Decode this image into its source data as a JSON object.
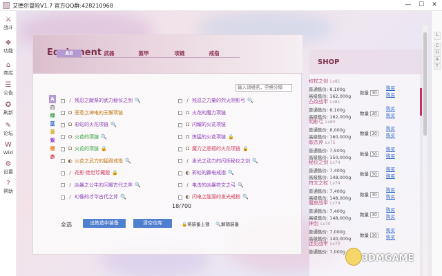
{
  "window": {
    "title": "艾德尔冒险V1.7 官方QQ群:428210968",
    "min": "—",
    "max": "☐",
    "close": "✕"
  },
  "sidebar": [
    {
      "icon": "⚔",
      "label": "战斗"
    },
    {
      "icon": "❖",
      "label": "功能"
    },
    {
      "icon": "⌂",
      "label": "商店"
    },
    {
      "icon": "☰",
      "label": "公告"
    },
    {
      "icon": "✪",
      "label": "刷新"
    },
    {
      "icon": "✎",
      "label": "论坛"
    },
    {
      "icon": "W",
      "label": "Wiki"
    },
    {
      "icon": "⚙",
      "label": "设置"
    },
    {
      "icon": "?",
      "label": "帮助"
    }
  ],
  "equipment": {
    "title": "Equipment",
    "tabs": [
      "All",
      "武器",
      "盔甲",
      "项链",
      "戒指"
    ],
    "search_placeholder": "输入词组名，空格分隔",
    "rarity": [
      "A",
      "白",
      "绿",
      "蓝",
      "黄",
      "紫",
      "橙",
      "赤"
    ],
    "left_items": [
      {
        "name": "残忍之献祭的武力秘仪之剑",
        "color": "#8a3db5",
        "wpn": "/",
        "tail": "🔍"
      },
      {
        "name": "恶意之神电的无懈项链",
        "color": "#c07a1a",
        "wpn": "Ω",
        "tail": ""
      },
      {
        "name": "彩虹的火花项链",
        "color": "#8a3db5",
        "wpn": "Ω",
        "tail": "🔍"
      },
      {
        "name": "火花的项链",
        "color": "#2f9b3b",
        "wpn": "Ω",
        "tail": "🔍"
      },
      {
        "name": "火花的项链",
        "color": "#2f9b3b",
        "wpn": "Ω",
        "tail": "🔒"
      },
      {
        "name": "火花之武力的猛踢戒指",
        "color": "#c07a1a",
        "wpn": "◐",
        "tail": "🔍"
      },
      {
        "name": "花影·绝世珍藏版",
        "color": "#d23a5a",
        "wpn": "/",
        "tail": "🔒"
      },
      {
        "name": "凶暴之公牛的闪耀古代之斧",
        "color": "#8a3db5",
        "wpn": "/",
        "tail": "🔍"
      },
      {
        "name": "幻像的才华古代之斧",
        "color": "#8a3db5",
        "wpn": "/",
        "tail": "🔍"
      }
    ],
    "right_items": [
      {
        "name": "残忍之力量的烈火阴影弓",
        "color": "#8a3db5",
        "wpn": "/",
        "tail": "🔍"
      },
      {
        "name": "火花的魔力项链",
        "color": "#8a3db5",
        "wpn": "Ω",
        "tail": ""
      },
      {
        "name": "闪耀的火花项链",
        "color": "#8a3db5",
        "wpn": "Ω",
        "tail": ""
      },
      {
        "name": "炼猛的火花项链",
        "color": "#8a3db5",
        "wpn": "Ω",
        "tail": "🔒"
      },
      {
        "name": "魔力之恶德的火花项链",
        "color": "#d23a5a",
        "wpn": "Ω",
        "tail": "🔒"
      },
      {
        "name": "发光之动力的闪烁秘仪之剑",
        "color": "#8a3db5",
        "wpn": "/",
        "tail": "🔍"
      },
      {
        "name": "彩虹的霹电戒指",
        "color": "#8a3db5",
        "wpn": "◐",
        "tail": "🔍"
      },
      {
        "name": "电击的凶暴符文之弓",
        "color": "#8a3db5",
        "wpn": "/",
        "tail": "🔍"
      },
      {
        "name": "闪电之能源的发光戒指",
        "color": "#d23a5a",
        "wpn": "◐",
        "tail": "🔍"
      }
    ],
    "count": "18/700",
    "select_all": "全选",
    "btn_sell": "出售选中装备",
    "btn_clear": "清空仓库",
    "note_lock": "🔒将装备上锁",
    "note_unlock": "🔍解锁装备"
  },
  "shop": {
    "title": "SHOP",
    "items": [
      {
        "name": "权杖之剑",
        "lv": "Lv81",
        "p1": "普通售价:",
        "v1": "8,100g",
        "p2": "高级售价:",
        "v2": "162,000g",
        "qty_label": "数量",
        "qty": "30",
        "buy1": "购买",
        "buy2": "购买"
      },
      {
        "name": "凸纹战甲",
        "lv": "Lv81",
        "p1": "普通售价:",
        "v1": "8,100g",
        "p2": "高级售价:",
        "v2": "162,000g",
        "qty_label": "数量",
        "qty": "30",
        "buy1": "购买",
        "buy2": "购买"
      },
      {
        "name": "明影弓",
        "lv": "Lv80",
        "p1": "普通售价:",
        "v1": "8,000g",
        "p2": "高级售价:",
        "v2": "160,000g",
        "qty_label": "数量",
        "qty": "30",
        "buy1": "购买",
        "buy2": "购买"
      },
      {
        "name": "歌杰斧",
        "lv": "Lv75",
        "p1": "普通售价:",
        "v1": "7,500g",
        "p2": "高级售价:",
        "v2": "150,000g",
        "qty_label": "数量",
        "qty": "30",
        "buy1": "购买",
        "buy2": "购买"
      },
      {
        "name": "秘仪之剑",
        "lv": "Lv74",
        "p1": "普通售价:",
        "v1": "7,400g",
        "p2": "高级售价:",
        "v2": "148,000g",
        "qty_label": "数量",
        "qty": "30",
        "buy1": "购买",
        "buy2": "购买"
      },
      {
        "name": "符文之杖",
        "lv": "Lv74",
        "p1": "普通售价:",
        "v1": "7,400g",
        "p2": "高级售价:",
        "v2": "148,000g",
        "qty_label": "数量",
        "qty": "30",
        "buy1": "购买",
        "buy2": "购买"
      },
      {
        "name": "魔皮战甲",
        "lv": "Lv74",
        "p1": "普通售价:",
        "v1": "7,400g",
        "p2": "高级售价:",
        "v2": "148,000g",
        "qty_label": "数量",
        "qty": "30",
        "buy1": "购买",
        "buy2": "购买"
      },
      {
        "name": "神剑",
        "lv": "Lv70",
        "p1": "普通售价:",
        "v1": "7,000g",
        "p2": "高级售价:",
        "v2": "140,000g",
        "qty_label": "数量",
        "qty": "30",
        "buy1": "购买",
        "buy2": "购买"
      },
      {
        "name": "连犯战甲",
        "lv": "Lv70",
        "p1": "普通售价:",
        "v1": "7,000g",
        "p2": "",
        "v2": "",
        "qty_label": "",
        "qty": "",
        "buy1": "",
        "buy2": ""
      }
    ]
  },
  "right_strip": [
    "L",
    "C",
    "H",
    "A",
    "T"
  ],
  "watermark": "3DMGAME"
}
